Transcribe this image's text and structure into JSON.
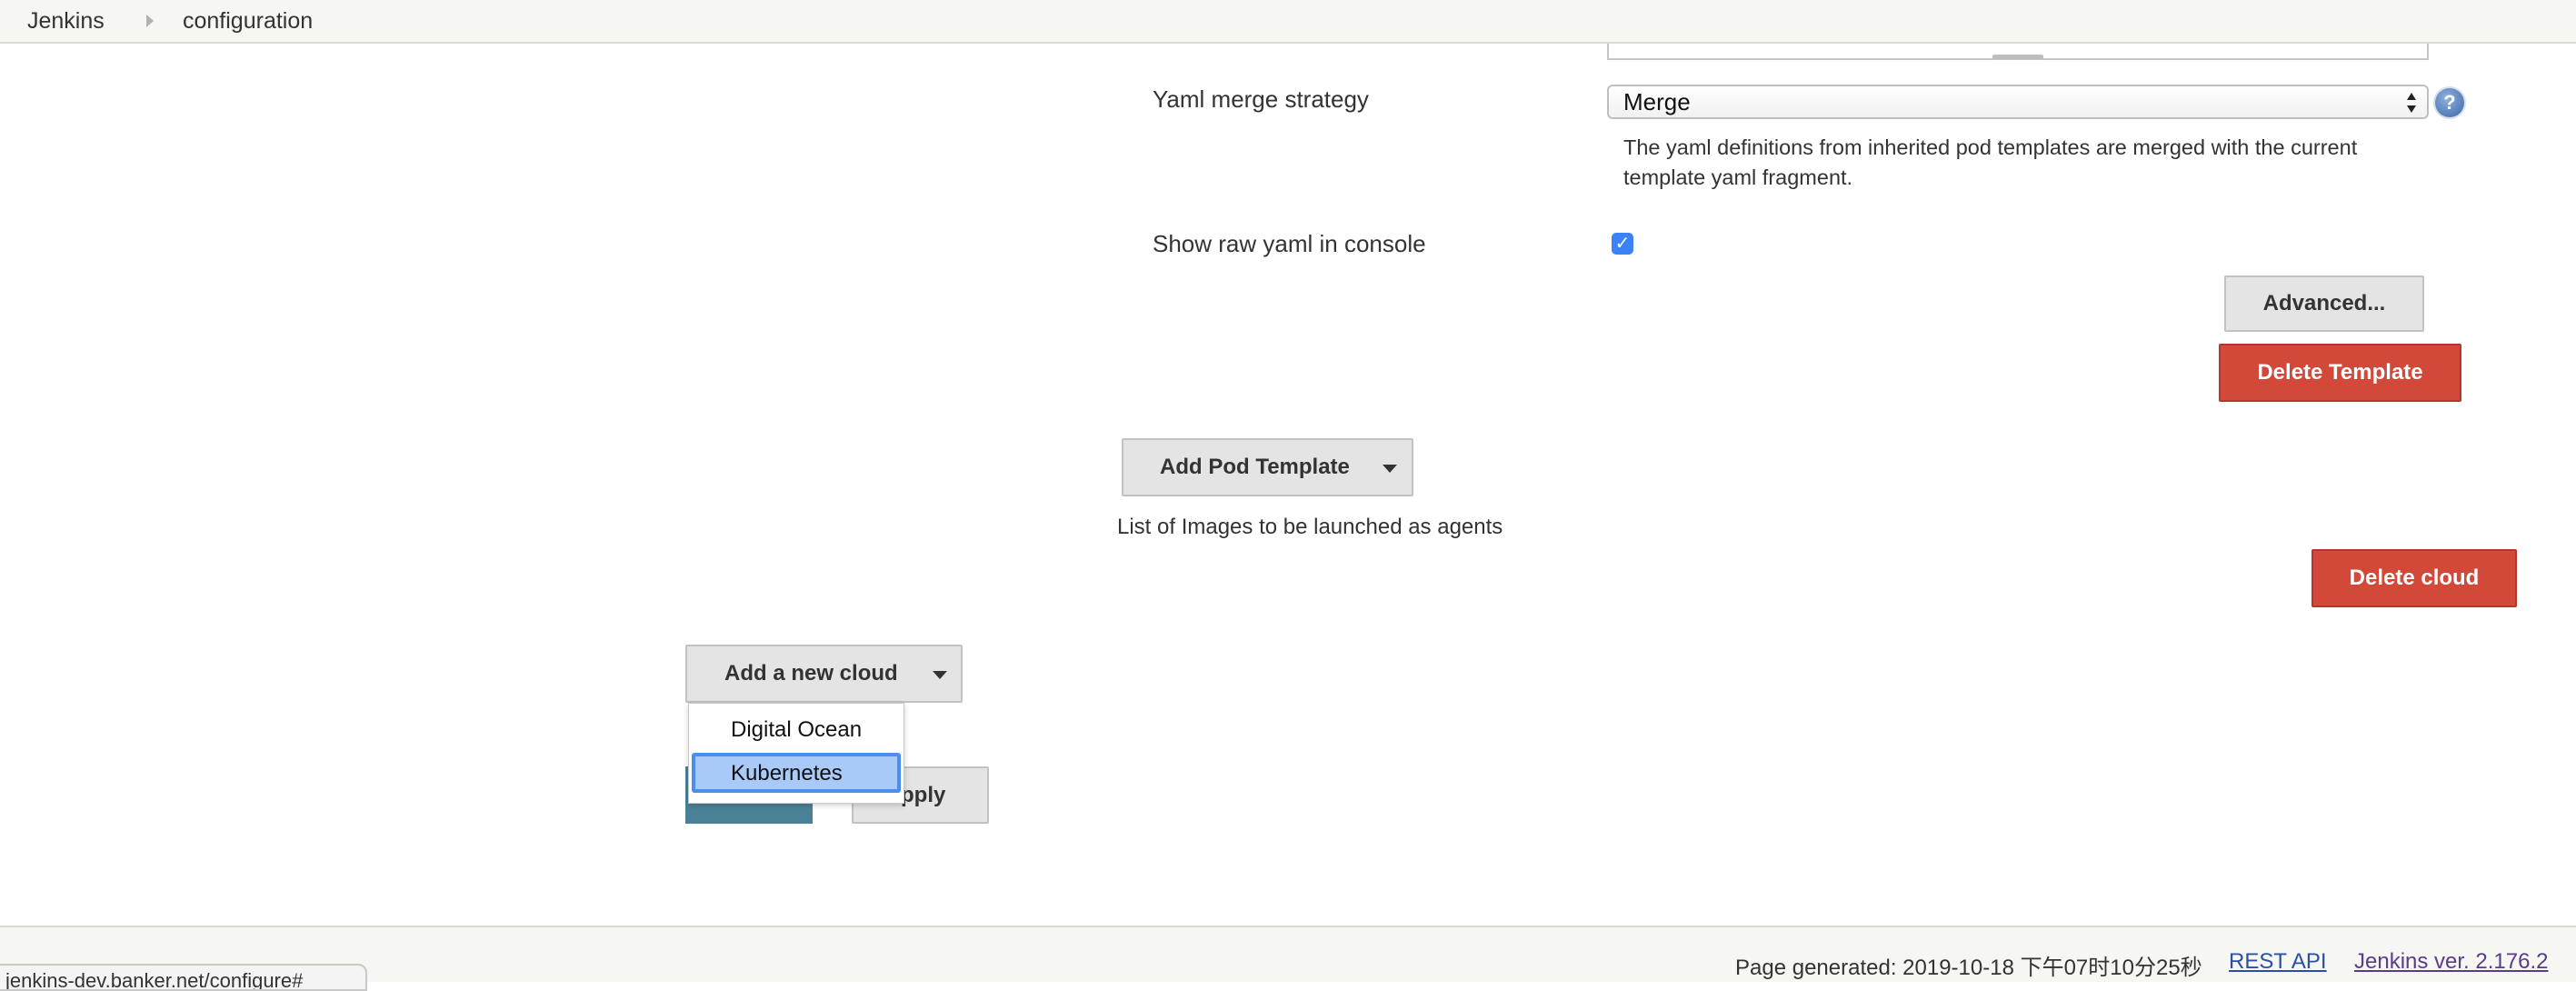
{
  "breadcrumb": {
    "items": [
      "Jenkins",
      "configuration"
    ]
  },
  "yaml_merge": {
    "label": "Yaml merge strategy",
    "selected": "Merge",
    "help_icon": "help-question-icon",
    "help_text": "?",
    "description_line1": "The yaml definitions from inherited pod templates are merged with the current",
    "description_line2": "template yaml fragment."
  },
  "show_raw_yaml": {
    "label": "Show raw yaml in console",
    "checked": true,
    "check_glyph": "✓"
  },
  "template_buttons": {
    "advanced": "Advanced...",
    "delete_template": "Delete Template"
  },
  "pod_template": {
    "add_button": "Add Pod Template",
    "caption": "List of Images to be launched as agents"
  },
  "cloud": {
    "delete_button": "Delete cloud",
    "add_button": "Add a new cloud",
    "menu_items": [
      "Digital Ocean",
      "Kubernetes"
    ],
    "selected_item": "Kubernetes"
  },
  "form_buttons": {
    "apply_partial": "pply"
  },
  "footer": {
    "page_generated": "Page generated: 2019-10-18 下午07时10分25秒",
    "rest_api": "REST API",
    "jenkins_version": "Jenkins ver. 2.176.2"
  },
  "status_bar": {
    "url": "jenkins-dev.banker.net/configure#"
  },
  "colors": {
    "danger": "#d24939",
    "selection": "#4a8ef0",
    "checkbox": "#3b82f6",
    "save_button": "#4b8196"
  }
}
